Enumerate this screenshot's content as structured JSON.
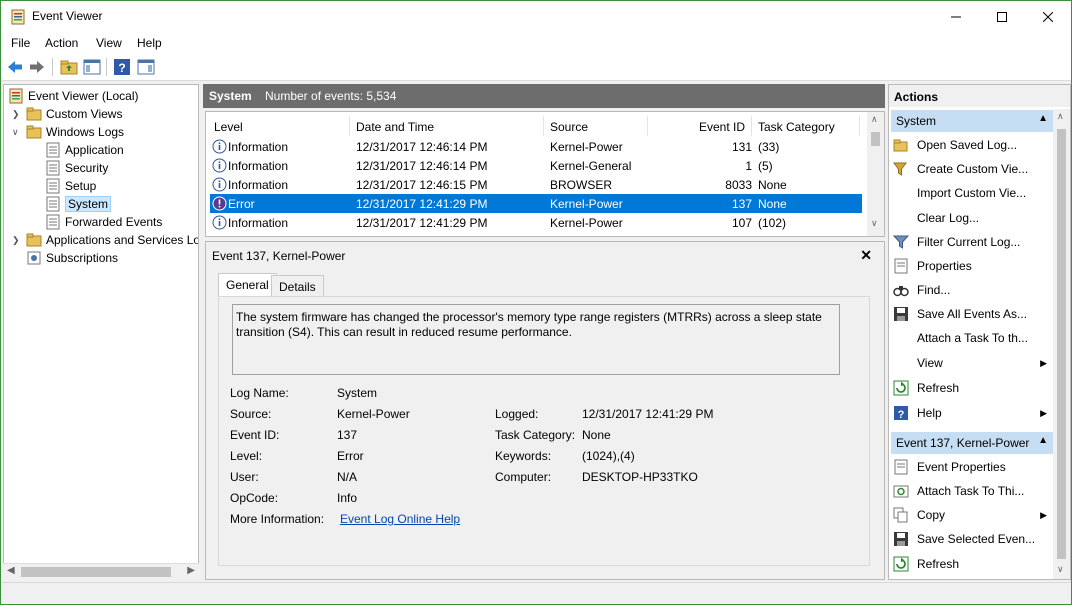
{
  "window": {
    "title": "Event Viewer"
  },
  "menu": [
    "File",
    "Action",
    "View",
    "Help"
  ],
  "tree": {
    "root": "Event Viewer (Local)",
    "custom_views": "Custom Views",
    "windows_logs": "Windows Logs",
    "logs": [
      "Application",
      "Security",
      "Setup",
      "System",
      "Forwarded Events"
    ],
    "apps_services": "Applications and Services Lo",
    "subscriptions": "Subscriptions"
  },
  "center": {
    "log_name": "System",
    "events_count": "Number of events: 5,534",
    "columns": [
      "Level",
      "Date and Time",
      "Source",
      "Event ID",
      "Task Category"
    ],
    "rows": [
      {
        "level": "Information",
        "date": "12/31/2017 12:46:14 PM",
        "source": "Kernel-Power",
        "id": "131",
        "task": "(33)"
      },
      {
        "level": "Information",
        "date": "12/31/2017 12:46:14 PM",
        "source": "Kernel-General",
        "id": "1",
        "task": "(5)"
      },
      {
        "level": "Information",
        "date": "12/31/2017 12:46:15 PM",
        "source": "BROWSER",
        "id": "8033",
        "task": "None"
      },
      {
        "level": "Error",
        "date": "12/31/2017 12:41:29 PM",
        "source": "Kernel-Power",
        "id": "137",
        "task": "None"
      },
      {
        "level": "Information",
        "date": "12/31/2017 12:41:29 PM",
        "source": "Kernel-Power",
        "id": "107",
        "task": "(102)"
      }
    ]
  },
  "detail": {
    "title": "Event 137, Kernel-Power",
    "tabs": [
      "General",
      "Details"
    ],
    "message": "The system firmware has changed the processor's memory type range registers (MTRRs) across a sleep state transition (S4). This can result in reduced resume performance.",
    "labels": {
      "log_name": "Log Name:",
      "source": "Source:",
      "event_id": "Event ID:",
      "level": "Level:",
      "user": "User:",
      "opcode": "OpCode:",
      "more_info": "More Information:",
      "logged": "Logged:",
      "task_category": "Task Category:",
      "keywords": "Keywords:",
      "computer": "Computer:"
    },
    "values": {
      "log_name": "System",
      "source": "Kernel-Power",
      "event_id": "137",
      "level": "Error",
      "user": "N/A",
      "opcode": "Info",
      "more_info": "Event Log Online Help",
      "logged": "12/31/2017 12:41:29 PM",
      "task_category": "None",
      "keywords": "(1024),(4)",
      "computer": "DESKTOP-HP33TKO"
    }
  },
  "actions": {
    "title": "Actions",
    "group1": "System",
    "group1_items": [
      "Open Saved Log...",
      "Create Custom Vie...",
      "Import Custom Vie...",
      "Clear Log...",
      "Filter Current Log...",
      "Properties",
      "Find...",
      "Save All Events As...",
      "Attach a Task To th...",
      "View",
      "Refresh",
      "Help"
    ],
    "group2": "Event 137, Kernel-Power",
    "group2_items": [
      "Event Properties",
      "Attach Task To Thi...",
      "Copy",
      "Save Selected Even...",
      "Refresh"
    ]
  },
  "colors": {
    "selection": "#0078d7",
    "header_bg": "#6d6d6d",
    "group_bg": "#c6def3"
  }
}
